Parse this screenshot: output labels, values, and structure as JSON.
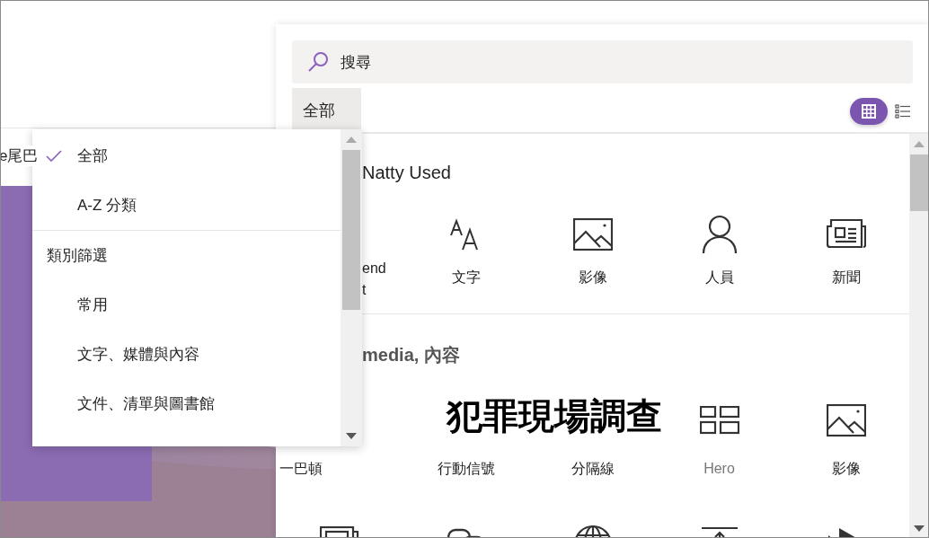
{
  "background_label": "e尾巴",
  "dropdown": {
    "items": [
      {
        "kind": "option",
        "label": "全部",
        "selected": true
      },
      {
        "kind": "option",
        "label": "A-Z 分類",
        "selected": false
      },
      {
        "kind": "divider"
      },
      {
        "kind": "header",
        "label": "類別篩選"
      },
      {
        "kind": "option",
        "label": "常用",
        "selected": false
      },
      {
        "kind": "option",
        "label": "文字、媒體與內容",
        "selected": false
      },
      {
        "kind": "option",
        "label": "文件、清單與圖書館",
        "selected": false
      }
    ]
  },
  "panel": {
    "search": {
      "value": "搜尋"
    },
    "filter_tab": {
      "label": "全部"
    },
    "view_toggle": [
      {
        "kind": "grid",
        "selected": true
      },
      {
        "kind": "list",
        "selected": false
      }
    ],
    "sections": [
      {
        "title": "Natty Used",
        "items": [
          {
            "label": "end\nt",
            "dimmed": false
          },
          {
            "label": "文字",
            "dimmed": false
          },
          {
            "label": "影像",
            "dimmed": false
          },
          {
            "label": "人員",
            "dimmed": false
          },
          {
            "label": "新聞",
            "dimmed": false
          }
        ]
      },
      {
        "title": "media, 內容",
        "overlay_text": "犯罪現場調查",
        "items": [
          {
            "label": "一巴頓",
            "dimmed": false
          },
          {
            "label": "行動信號",
            "dimmed": false
          },
          {
            "label": "分隔線",
            "dimmed": false
          },
          {
            "label": "Hero",
            "dimmed": true
          },
          {
            "label": "影像",
            "dimmed": false
          }
        ]
      }
    ]
  }
}
